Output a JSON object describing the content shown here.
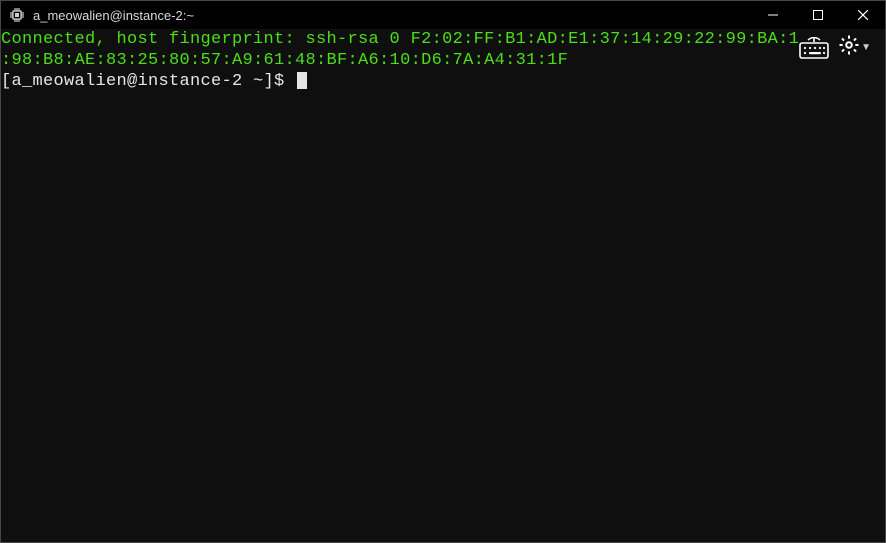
{
  "titlebar": {
    "title": "a_meowalien@instance-2:~",
    "app_icon": "chip-icon"
  },
  "window_controls": {
    "minimize": "minimize",
    "maximize": "maximize",
    "close": "close"
  },
  "terminal": {
    "line1": "Connected, host fingerprint: ssh-rsa 0 F2:02:FF:B1:AD:E1:37:14:29:22:99:BA:1",
    "line2": ":98:B8:AE:83:25:80:57:A9:61:48:BF:A6:10:D6:7A:A4:31:1F",
    "prompt": "[a_meowalien@instance-2 ~]$ "
  },
  "overlay": {
    "keyboard_icon": "keyboard-icon",
    "settings_icon": "gear-icon"
  }
}
